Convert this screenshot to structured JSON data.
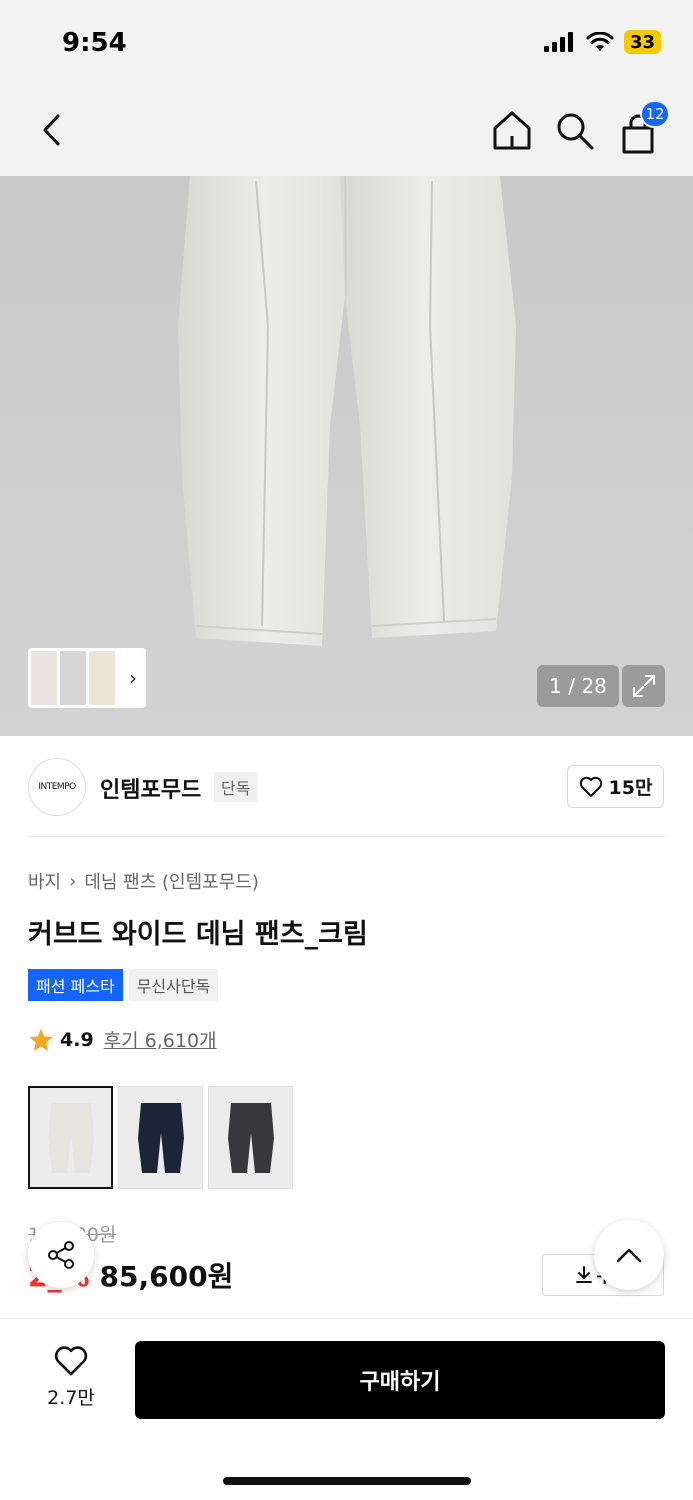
{
  "status_bar": {
    "time": "9:54",
    "battery": "33"
  },
  "nav": {
    "cart_count": "12"
  },
  "gallery": {
    "counter": "1 / 28"
  },
  "brand": {
    "logo_text": "INTEMPO",
    "name": "인템포무드",
    "tag": "단독",
    "likes": "15만"
  },
  "breadcrumb": [
    "바지",
    "데님 팬츠 (인템포무드)"
  ],
  "product": {
    "title": "커브드 와이드 데님 팬츠_크림",
    "badges": [
      "패션 페스타",
      "무신사단독"
    ],
    "rating": "4.9",
    "reviews": "후기 6,610개"
  },
  "colors": [
    {
      "name": "cream",
      "hex": "#e6e4df"
    },
    {
      "name": "navy",
      "hex": "#1e2438"
    },
    {
      "name": "charcoal",
      "hex": "#38383a"
    }
  ],
  "price": {
    "original": "1__,_00원",
    "discount": "2_%",
    "current": "85,600원",
    "coupon_label": "쿠폰"
  },
  "bottom": {
    "wish_count": "2.7만",
    "buy_label": "구매하기"
  },
  "theme": {
    "accent": "#1464ff",
    "sale_red": "#ff2f2f"
  }
}
